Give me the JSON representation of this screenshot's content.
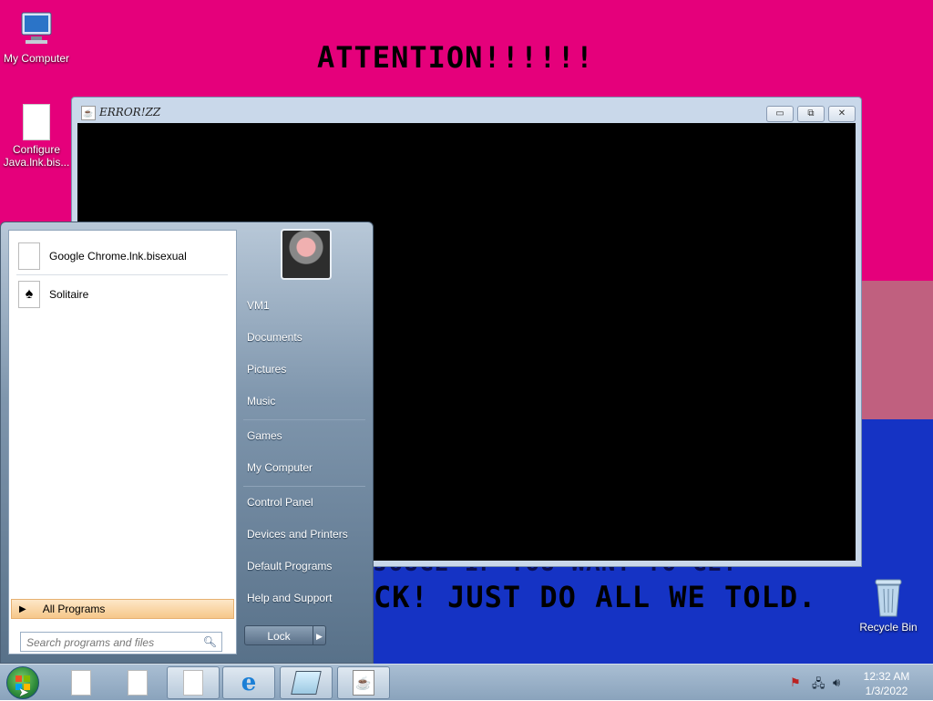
{
  "desktop": {
    "banner_top": "ATTENTION!!!!!!",
    "banner_bottom": "CK! JUST DO ALL WE TOLD.",
    "banner_partial": "JOUGE IF YOU WANT TO GET",
    "icons": [
      {
        "label": "My Computer",
        "icon": "computer-icon"
      },
      {
        "label": "Configure Java.lnk.bis...",
        "icon": "file-icon"
      },
      {
        "label": "Recycle Bin",
        "icon": "recycle-bin-icon"
      }
    ]
  },
  "window": {
    "title": "ERROR!ZZ",
    "buttons": {
      "minimize": "▭",
      "restore": "⧉",
      "close": "✕"
    }
  },
  "start_menu": {
    "programs": [
      {
        "label": "Google Chrome.lnk.bisexual",
        "icon": "file-icon"
      },
      {
        "label": "Solitaire",
        "icon": "solitaire-icon"
      }
    ],
    "all_programs": "All Programs",
    "search_placeholder": "Search programs and files",
    "right_links": [
      "VM1",
      "Documents",
      "Pictures",
      "Music",
      "Games",
      "My Computer",
      "Control Panel",
      "Devices and Printers",
      "Default Programs",
      "Help and Support"
    ],
    "lock_label": "Lock"
  },
  "taskbar": {
    "clock_time": "12:32 AM",
    "clock_date": "1/3/2022"
  }
}
